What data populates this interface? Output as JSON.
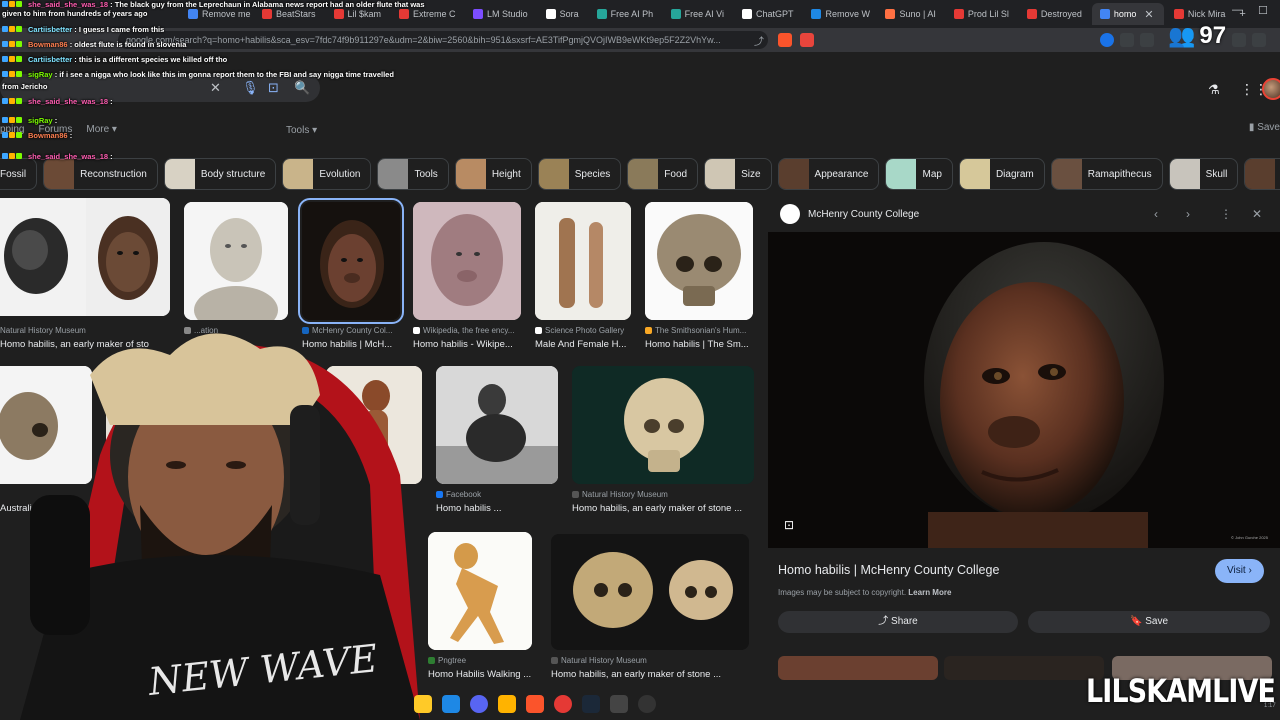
{
  "browser": {
    "tabs": [
      {
        "label": "Remove me / X",
        "color": "#4285f4"
      },
      {
        "label": "BeatStars",
        "color": "#e53935"
      },
      {
        "label": "Lil $kam",
        "color": "#e53935"
      },
      {
        "label": "Extreme C",
        "color": "#e53935"
      },
      {
        "label": "LM Studio",
        "color": "#7c4dff"
      },
      {
        "label": "Sora",
        "color": "#ffffff"
      },
      {
        "label": "Free AI Ph",
        "color": "#26a69a"
      },
      {
        "label": "Free AI Vi",
        "color": "#26a69a"
      },
      {
        "label": "ChatGPT",
        "color": "#ffffff"
      },
      {
        "label": "Remove W",
        "color": "#1e88e5"
      },
      {
        "label": "Suno | AI",
        "color": "#ff7043"
      },
      {
        "label": "Prod Lil Sl",
        "color": "#e53935"
      },
      {
        "label": "Destroyed",
        "color": "#e53935"
      },
      {
        "label": "homo",
        "color": "#4285f4",
        "active": true
      },
      {
        "label": "Nick Mira",
        "color": "#e53935"
      }
    ],
    "tab_close": "✕",
    "new_tab": "+",
    "window_controls": {
      "minimize": "—",
      "maximize": "☐"
    },
    "url": "google.com/search?q=homo+habilis&sca_esv=7fdc74f9b911297e&udm=2&biw=2560&bih=951&sxsrf=AE3TifPgmjQVOjIWB9eWKt9ep5F2Z2VhYw..."
  },
  "google": {
    "search": {
      "clear": "✕",
      "voice": "🎙",
      "lens": "⊡",
      "search": "🔍"
    },
    "nav_tabs": [
      "pping",
      "Forums",
      "More ▾"
    ],
    "tools_label": "Tools ▾",
    "saved_label": "Save",
    "labs_icon": "flask-icon",
    "apps_icon": "apps-grid-icon"
  },
  "stream": {
    "viewer_count": "97",
    "brand": "LILSKAMLIVE",
    "clock": "1:17"
  },
  "chips": [
    {
      "label": "Fossil",
      "first": true,
      "thumb": "#5a4a3a"
    },
    {
      "label": "Reconstruction",
      "thumb": "#6b4a36"
    },
    {
      "label": "Body structure",
      "thumb": "#d8d2c4"
    },
    {
      "label": "Evolution",
      "thumb": "#c9b48a"
    },
    {
      "label": "Tools",
      "thumb": "#8a8a8a"
    },
    {
      "label": "Height",
      "thumb": "#b88b63"
    },
    {
      "label": "Species",
      "thumb": "#9a8256"
    },
    {
      "label": "Food",
      "thumb": "#8a7a5a"
    },
    {
      "label": "Size",
      "thumb": "#cfc6b4"
    },
    {
      "label": "Appearance",
      "thumb": "#5a3e2e"
    },
    {
      "label": "Map",
      "thumb": "#a8d8c8"
    },
    {
      "label": "Diagram",
      "thumb": "#d6c89a"
    },
    {
      "label": "Ramapithecus",
      "thumb": "#6a5040"
    },
    {
      "label": "Skull",
      "thumb": "#c8c4bc"
    },
    {
      "label": "",
      "thumb": "#5a3e2e"
    }
  ],
  "results": [
    {
      "source": "Natural History Museum",
      "title": "Homo habilis, an early maker of sto",
      "dot": "#2e7d32"
    },
    {
      "source": "",
      "title": "",
      "dot": ""
    },
    {
      "source": "...ation",
      "title": "",
      "dot": "#888888"
    },
    {
      "source": "McHenry County Col...",
      "title": "Homo habilis | McH...",
      "dot": "#1565c0"
    },
    {
      "source": "Wikipedia, the free ency...",
      "title": "Homo habilis - Wikipe...",
      "dot": "#ffffff"
    },
    {
      "source": "Science Photo Gallery",
      "title": "Male And Female H...",
      "dot": "#ffffff"
    },
    {
      "source": "The Smithsonian's Hum...",
      "title": "Homo habilis | The Sm...",
      "dot": "#f9a825"
    },
    {
      "source": "",
      "title": "Australian Muse",
      "dot": ""
    },
    {
      "source": "Facebook",
      "title": "Homo habilis ...",
      "dot": "#1877f2"
    },
    {
      "source": "Natural History Museum",
      "title": "Homo habilis, an early maker of stone ...",
      "dot": "#555555"
    },
    {
      "source": "Pngtree",
      "title": "Homo Habilis Walking ...",
      "dot": "#2e7d32"
    },
    {
      "source": "Natural History Museum",
      "title": "Homo habilis, an early maker of stone ...",
      "dot": "#555555"
    }
  ],
  "preview": {
    "site": "McHenry County College",
    "title": "Homo habilis | McHenry County College",
    "visit": "Visit ›",
    "copyright": "Images may be subject to copyright.",
    "learn_more": "Learn More",
    "share": "⤴ Share",
    "save": "🔖 Save",
    "image_credit": "© John Gurche 2025",
    "prev": "‹",
    "next": "›",
    "more": "⋮",
    "close": "✕",
    "lens": "⊡"
  },
  "chat": [
    {
      "user": "she_said_she_was_18",
      "text": "The black guy from the Leprechaun in Alabama news report had an older flute that was",
      "user_color": "#ff5db1"
    },
    {
      "user": "",
      "text": "given to him from hundreds of years ago",
      "user_color": ""
    },
    {
      "user": "Cartiisbetter",
      "text": "I guess I came from this",
      "user_color": "#7fe3ff"
    },
    {
      "user": "Bowman86",
      "text": "oldest flute is found in slovenia",
      "user_color": "#ff7f50"
    },
    {
      "user": "Cartiisbetter",
      "text": "this is a different species we killed off tho",
      "user_color": "#7fe3ff"
    },
    {
      "user": "sigRay",
      "text": "if i see a nigga who look like this im gonna report them to the FBI and say nigga time travelled",
      "user_color": "#7cfc00"
    },
    {
      "user": "",
      "text": "from Jericho",
      "user_color": ""
    },
    {
      "user": "she_said_she_was_18",
      "text": "",
      "user_color": "#ff5db1"
    },
    {
      "user": "sigRay",
      "text": "",
      "user_color": "#7cfc00"
    },
    {
      "user": "Bowman86",
      "text": "",
      "user_color": "#ff7f50"
    },
    {
      "user": "she_said_she_was_18",
      "text": "",
      "user_color": "#ff5db1"
    }
  ],
  "taskbar": [
    "file-explorer-icon",
    "store-icon",
    "discord-icon",
    "app-icon",
    "brave-icon",
    "chrome-icon",
    "steam-icon",
    "app2-icon",
    "4k-icon"
  ]
}
